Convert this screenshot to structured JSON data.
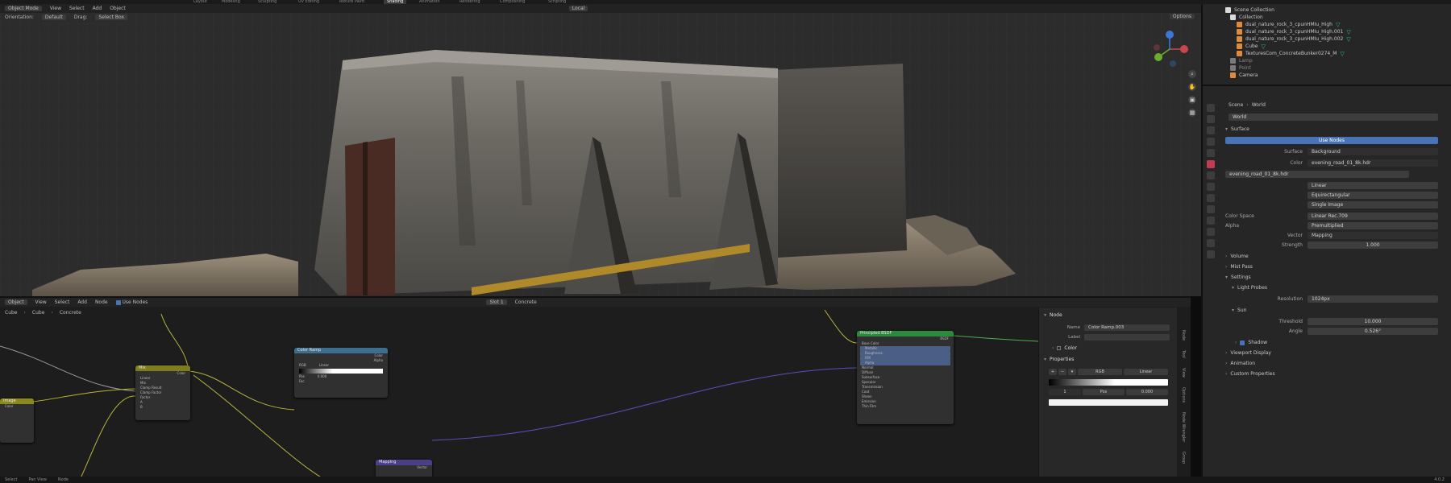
{
  "top_menu": [
    "Layout",
    "Modeling",
    "Sculpting",
    "UV Editing",
    "Texture Paint",
    "Shading",
    "Animation",
    "Rendering",
    "Compositing",
    "Scripting"
  ],
  "viewport": {
    "mode": "Object Mode",
    "menus": [
      "View",
      "Select",
      "Add",
      "Object"
    ],
    "orientation_label": "Orientation:",
    "orientation": "Default",
    "drag_label": "Drag:",
    "drag": "Select Box",
    "transform": "Local",
    "options": "Options"
  },
  "outliner": {
    "items": [
      {
        "name": "Scene Collection",
        "kind": "coll"
      },
      {
        "name": "Collection",
        "kind": "coll"
      },
      {
        "name": "dual_nature_rock_3_cpunHMIu_High",
        "kind": "mesh"
      },
      {
        "name": "dual_nature_rock_3_cpunHMIu_High.001",
        "kind": "mesh"
      },
      {
        "name": "dual_nature_rock_3_cpunHMIu_High.002",
        "kind": "mesh"
      },
      {
        "name": "Cube",
        "kind": "mesh"
      },
      {
        "name": "TexturesCom_ConcreteBunker0274_M",
        "kind": "mesh"
      },
      {
        "name": "Lamp",
        "kind": "cam"
      },
      {
        "name": "Point",
        "kind": "cam"
      },
      {
        "name": "Camera",
        "kind": "cam"
      }
    ]
  },
  "properties": {
    "scene": "Scene",
    "world": "World",
    "world_name": "World",
    "surface_section": "Surface",
    "use_nodes": "Use Nodes",
    "surface_label": "Surface",
    "surface_value": "Background",
    "color_label": "Color",
    "color_value": "evening_road_01_8k.hdr",
    "image_name": "evening_road_01_8k.hdr",
    "interp": "Linear",
    "projection": "Equirectangular",
    "source": "Single Image",
    "color_space_label": "Color Space",
    "color_space_value": "Linear Rec.709",
    "alpha_label": "Alpha",
    "alpha_value": "Premultiplied",
    "vector_label": "Vector",
    "vector_value": "Mapping",
    "strength_label": "Strength",
    "strength_value": "1.000",
    "volume": "Volume",
    "mist_pass": "Mist Pass",
    "settings": "Settings",
    "light_probes": "Light Probes",
    "resolution_label": "Resolution",
    "resolution_value": "1024px",
    "sun": "Sun",
    "threshold_label": "Threshold",
    "threshold_value": "10.000",
    "angle_label": "Angle",
    "angle_value": "0.526°",
    "shadow": "Shadow",
    "viewport_display": "Viewport Display",
    "animation": "Animation",
    "custom_properties": "Custom Properties"
  },
  "node_editor": {
    "object_label": "Object",
    "menus": [
      "View",
      "Select",
      "Add",
      "Node"
    ],
    "use_nodes": "Use Nodes",
    "slot": "Slot 1",
    "material": "Concrete",
    "breadcrumb": [
      "Cube",
      "Cube",
      "Concrete"
    ],
    "nodes": {
      "mix": {
        "title": "Mix",
        "rows": [
          "Color",
          "Linear",
          "Mix",
          "Clamp Result",
          "Clamp Factor",
          "Factor",
          "A",
          "B"
        ]
      },
      "color_ramp": {
        "title": "Color Ramp",
        "rows": [
          "Color",
          "Alpha",
          "RGB",
          "Linear",
          "Pos",
          "0.000",
          "Fac"
        ]
      },
      "bsdf": {
        "title": "Principled BSDF",
        "rows": [
          "BSDF",
          "Base Color",
          "Metallic",
          "Roughness",
          "IOR",
          "Alpha",
          "Normal",
          "Diffuse",
          "Subsurface",
          "Specular",
          "Transmission",
          "Coat",
          "Sheen",
          "Emission",
          "Thin Film"
        ]
      },
      "mapping": {
        "title": "Mapping",
        "rows": [
          "Vector"
        ]
      },
      "small": {
        "title": "Image",
        "rows": [
          "Color"
        ]
      }
    },
    "sidebar": {
      "node_header": "Node",
      "name_label": "Name",
      "name_value": "Color Ramp.003",
      "label_label": "Label",
      "label_value": "",
      "color_header": "Color",
      "properties_header": "Properties",
      "rgb": "RGB",
      "interp": "Linear",
      "pos_label": "Pos",
      "pos_value": "0.000"
    },
    "tabs": [
      "Node",
      "Tool",
      "View",
      "Options",
      "Node Wrangler",
      "Group"
    ]
  },
  "statusbar": {
    "select": "Select",
    "pan": "Pan View",
    "node": "Node",
    "version": "4.0.2"
  },
  "colors": {
    "accent": "#4873b6",
    "wire_yellow": "#b7b53a",
    "wire_purple": "#5b4fbf",
    "wire_gray": "#9a9a9a"
  }
}
